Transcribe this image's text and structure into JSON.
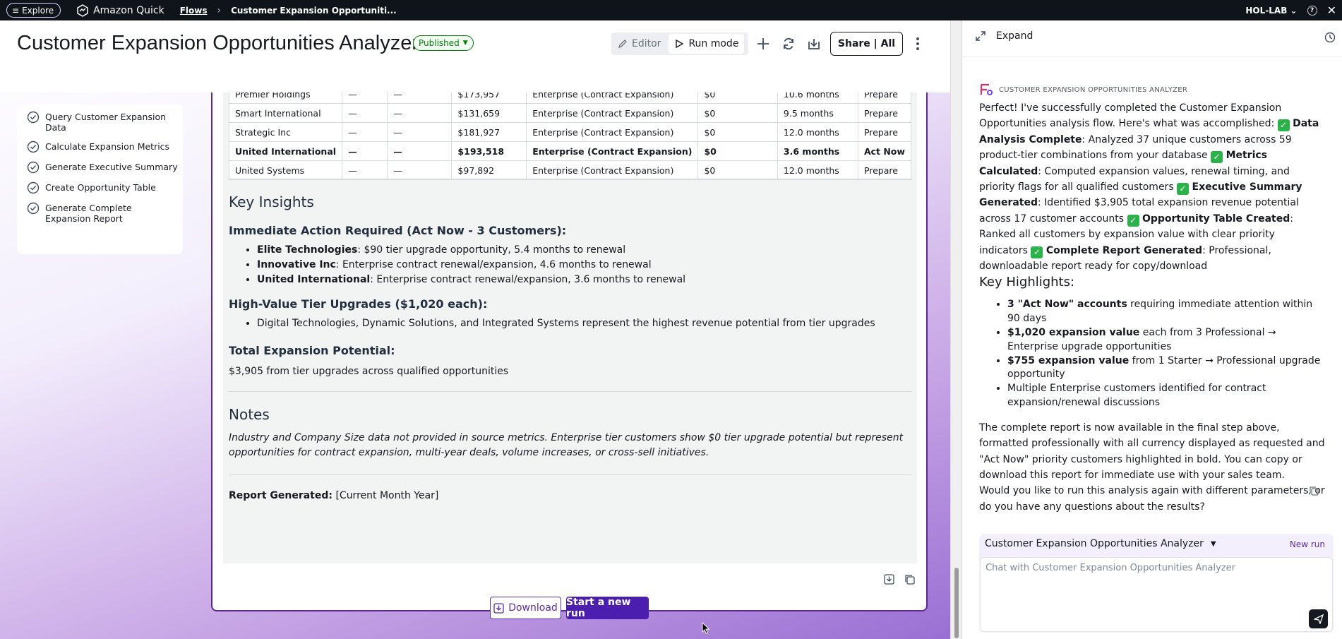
{
  "topbar": {
    "explore_label": "Explore",
    "brand": "Amazon Quick",
    "breadcrumb_flows": "Flows",
    "breadcrumb_current": "Customer Expansion Opportuniti...",
    "account": "HOL-LAB"
  },
  "header": {
    "title": "Customer Expansion Opportunities Analyzer",
    "status": "Published",
    "editor_label": "Editor",
    "run_mode_label": "Run mode",
    "share_label": "Share | All"
  },
  "steps": [
    {
      "label": "Query Customer Expansion Data"
    },
    {
      "label": "Calculate Expansion Metrics"
    },
    {
      "label": "Generate Executive Summary"
    },
    {
      "label": "Create Opportunity Table"
    },
    {
      "label": "Generate Complete Expansion Report"
    }
  ],
  "report": {
    "rows": [
      [
        "Premier Holdings",
        "—",
        "—",
        "$173,957",
        "Enterprise (Contract Expansion)",
        "$0",
        "10.6 months",
        "Prepare"
      ],
      [
        "Smart International",
        "—",
        "—",
        "$131,659",
        "Enterprise (Contract Expansion)",
        "$0",
        "9.5 months",
        "Prepare"
      ],
      [
        "Strategic Inc",
        "—",
        "—",
        "$181,927",
        "Enterprise (Contract Expansion)",
        "$0",
        "12.0 months",
        "Prepare"
      ],
      [
        "United International",
        "—",
        "—",
        "$193,518",
        "Enterprise (Contract Expansion)",
        "$0",
        "3.6 months",
        "Act Now"
      ],
      [
        "United Systems",
        "—",
        "—",
        "$97,892",
        "Enterprise (Contract Expansion)",
        "$0",
        "12.0 months",
        "Prepare"
      ]
    ],
    "key_insights_title": "Key Insights",
    "immediate_title": "Immediate Action Required (Act Now - 3 Customers):",
    "immediate_items": [
      {
        "name": "Elite Technologies",
        "text": ": $90 tier upgrade opportunity, 5.4 months to renewal"
      },
      {
        "name": "Innovative Inc",
        "text": ": Enterprise contract renewal/expansion, 4.6 months to renewal"
      },
      {
        "name": "United International",
        "text": ": Enterprise contract renewal/expansion, 3.6 months to renewal"
      }
    ],
    "high_value_title": "High-Value Tier Upgrades ($1,020 each):",
    "high_value_item": "Digital Technologies, Dynamic Solutions, and Integrated Systems represent the highest revenue potential from tier upgrades",
    "total_title": "Total Expansion Potential:",
    "total_text": "$3,905 from tier upgrades across qualified opportunities",
    "notes_title": "Notes",
    "notes_text": "Industry and Company Size data not provided in source metrics. Enterprise tier customers show $0 tier upgrade potential but represent opportunities for contract expansion, multi-year deals, volume increases, or cross-sell initiatives.",
    "generated_label": "Report Generated:",
    "generated_value": " [Current Month Year]"
  },
  "actions": {
    "download_label": "Download",
    "start_new_run_label": "Start a new run"
  },
  "panel": {
    "expand_label": "Expand",
    "agent_name": "CUSTOMER EXPANSION OPPORTUNITIES ANALYZER",
    "intro": "Perfect! I've successfully completed the Customer Expansion Opportunities analysis flow. Here's what was accomplished:",
    "accomplished": [
      {
        "title": "Data Analysis Complete",
        "text": ": Analyzed 37 unique customers across 59 product-tier combinations from your database "
      },
      {
        "title": "Metrics Calculated",
        "text": ": Computed expansion values, renewal timing, and priority flags for all qualified customers "
      },
      {
        "title": "Executive Summary Generated",
        "text": ": Identified $3,905 total expansion revenue potential across 17 customer accounts "
      },
      {
        "title": "Opportunity Table Created",
        "text": ": Ranked all customers by expansion value with clear priority indicators "
      },
      {
        "title": "Complete Report Generated",
        "text": ": Professional, downloadable report ready for copy/download"
      }
    ],
    "highlights_title": "Key Highlights:",
    "highlights": [
      {
        "bold": "3 \"Act Now\" accounts",
        "text": " requiring immediate attention within 90 days"
      },
      {
        "bold": "$1,020 expansion value",
        "text": " each from 3 Professional → Enterprise upgrade opportunities"
      },
      {
        "bold": "$755 expansion value",
        "text": " from 1 Starter → Professional upgrade opportunity"
      },
      {
        "bold": "",
        "text": "Multiple Enterprise customers identified for contract expansion/renewal discussions"
      }
    ],
    "closing": "The complete report is now available in the final step above, formatted professionally with all currency displayed as requested and \"Act Now\" priority customers highlighted in bold. You can copy or download this report for immediate use with your sales team.",
    "question": "Would you like to run this analysis again with different parameters, or do you have any questions about the results?",
    "chat_agent_label": "Customer Expansion Opportunities Analyzer",
    "new_run_label": "New run",
    "chat_placeholder": "Chat with Customer Expansion Opportunities Analyzer"
  },
  "colors": {
    "accent": "#5b2ea0",
    "primary_button": "#4b1eb0",
    "published": "#037f0c",
    "check": "#2bb34a"
  }
}
